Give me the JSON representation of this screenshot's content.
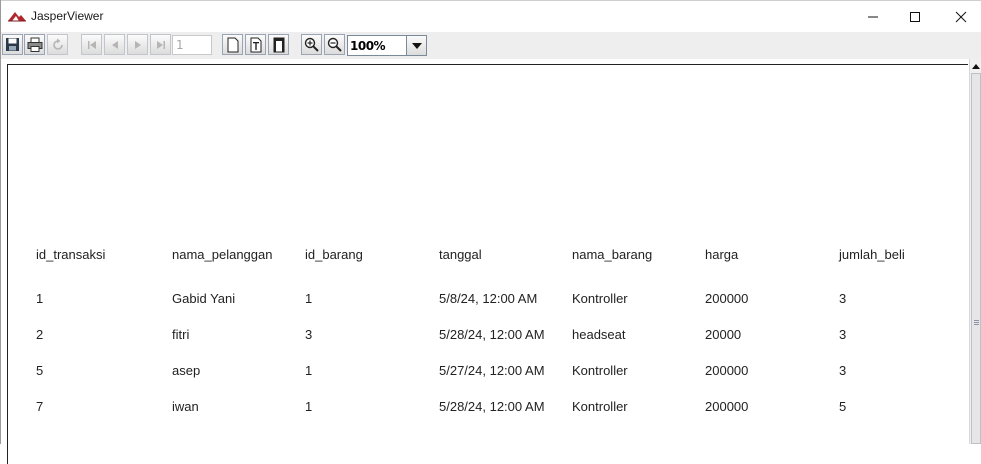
{
  "window": {
    "title": "JasperViewer",
    "controls": {
      "minimize": "minimize-icon",
      "maximize": "maximize-icon",
      "close": "close-icon"
    }
  },
  "toolbar": {
    "buttons": [
      {
        "name": "save-button",
        "icon": "floppy-disk-icon",
        "enabled": true
      },
      {
        "name": "print-button",
        "icon": "printer-icon",
        "enabled": true
      },
      {
        "name": "reload-button",
        "icon": "reload-icon",
        "enabled": false
      },
      {
        "name": "first-page-button",
        "icon": "first-page-icon",
        "enabled": false
      },
      {
        "name": "previous-page-button",
        "icon": "previous-page-icon",
        "enabled": false
      },
      {
        "name": "next-page-button",
        "icon": "next-page-icon",
        "enabled": false
      },
      {
        "name": "last-page-button",
        "icon": "last-page-icon",
        "enabled": false
      },
      {
        "name": "actual-size-button",
        "icon": "actual-size-icon",
        "enabled": true
      },
      {
        "name": "fit-page-button",
        "icon": "fit-page-icon",
        "enabled": true
      },
      {
        "name": "fit-width-button",
        "icon": "fit-width-icon",
        "enabled": true
      },
      {
        "name": "zoom-in-button",
        "icon": "zoom-in-icon",
        "enabled": true
      },
      {
        "name": "zoom-out-button",
        "icon": "zoom-out-icon",
        "enabled": true
      }
    ],
    "page_number": "1",
    "zoom": "100%"
  },
  "report": {
    "columns": [
      "id_transaksi",
      "nama_pelanggan",
      "id_barang",
      "tanggal",
      "nama_barang",
      "harga",
      "jumlah_beli"
    ],
    "rows": [
      [
        "1",
        "Gabid Yani",
        "1",
        "5/8/24, 12:00 AM",
        "Kontroller",
        "200000",
        "3"
      ],
      [
        "2",
        "fitri",
        "3",
        "5/28/24, 12:00 AM",
        "headseat",
        "20000",
        "3"
      ],
      [
        "5",
        "asep",
        "1",
        "5/27/24, 12:00 AM",
        "Kontroller",
        "200000",
        "3"
      ],
      [
        "7",
        "iwan",
        "1",
        "5/28/24, 12:00 AM",
        "Kontroller",
        "200000",
        "5"
      ]
    ]
  },
  "colors": {
    "page_background": "#ffffff",
    "chrome_background": "#eeeeee",
    "text": "#222222"
  }
}
